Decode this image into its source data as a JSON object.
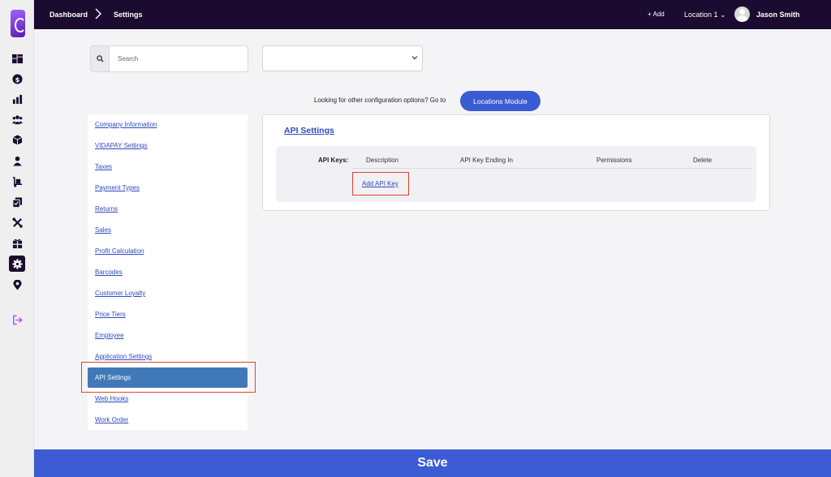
{
  "breadcrumb": {
    "home": "Dashboard",
    "current": "Settings"
  },
  "topbar": {
    "add_label": "+ Add",
    "location_label": "Location 1 ⌄",
    "user_name": "Jason Smith"
  },
  "rail": [
    "dashboard-icon",
    "dollar-icon",
    "bar-chart-icon",
    "users-icon",
    "box-icon",
    "person-icon",
    "dolly-icon",
    "documents-icon",
    "tools-icon",
    "gift-icon",
    "settings-gear-icon",
    "map-pin-icon",
    "logout-icon"
  ],
  "search": {
    "placeholder": "Search"
  },
  "config": {
    "text": "Looking for other configuration options? Go to",
    "button": "Locations Module"
  },
  "settings_menu": {
    "items": [
      "Company Information",
      "VIDAPAY Settings",
      "Taxes",
      "Payment Types",
      "Returns",
      "Sales",
      "Profit Calculation",
      "Barcodes",
      "Customer Loyalty",
      "Price Tiers",
      "Employee",
      "Application Settings",
      "API Settings",
      "Web Hooks",
      "Work Order"
    ],
    "active": "API Settings"
  },
  "api": {
    "title": "API Settings",
    "keys_label": "API Keys:",
    "columns": [
      "Description",
      "API Key Ending In",
      "Permissions",
      "Delete"
    ],
    "add_key": "Add API Key"
  },
  "colors": {
    "topbar": "#1b0b30",
    "accent": "#3c5bd4",
    "active_item": "#4179b8",
    "highlight": "#e0442c"
  },
  "save_label": "Save"
}
